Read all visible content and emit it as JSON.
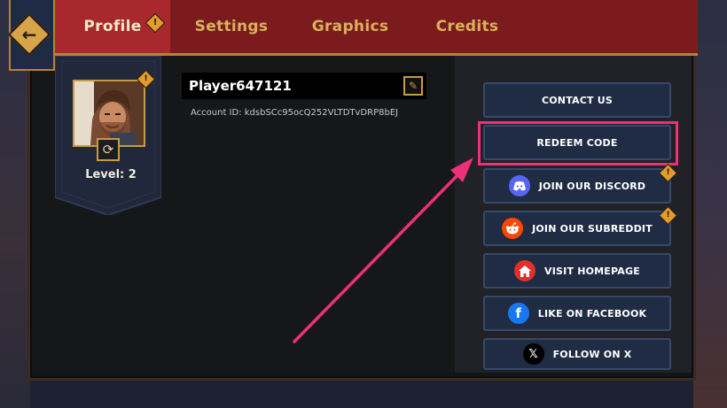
{
  "tabs": [
    {
      "label": "Profile",
      "active": true
    },
    {
      "label": "Settings",
      "active": false
    },
    {
      "label": "Graphics",
      "active": false
    },
    {
      "label": "Credits",
      "active": false
    }
  ],
  "profile": {
    "player_name": "Player647121",
    "account_id": "Account ID: kdsbSCc95ocQ252VLTDTvDRP8bEJ",
    "level": "Level: 2"
  },
  "menu": {
    "contact": "CONTACT US",
    "redeem": "REDEEM CODE",
    "discord": "JOIN OUR DISCORD",
    "subreddit": "JOIN OUR SUBREDDIT",
    "homepage": "VISIT HOMEPAGE",
    "facebook": "LIKE ON FACEBOOK",
    "x": "FOLLOW ON X"
  },
  "warn_glyph": "!",
  "colors": {
    "tab_bar": "#7c1b1d",
    "tab_active": "#a8282b",
    "tab_text": "#d9b15c",
    "button_bg": "#1f2c44",
    "highlight": "#ee2f7a",
    "discord": "#5865f2",
    "reddit": "#ff4500",
    "homepage": "#e0302c",
    "facebook": "#1877f2",
    "x": "#000000"
  },
  "icons": [
    "back-arrow-icon",
    "warning-icon",
    "refresh-icon",
    "edit-icon",
    "discord-icon",
    "reddit-icon",
    "home-icon",
    "facebook-icon",
    "x-icon"
  ]
}
